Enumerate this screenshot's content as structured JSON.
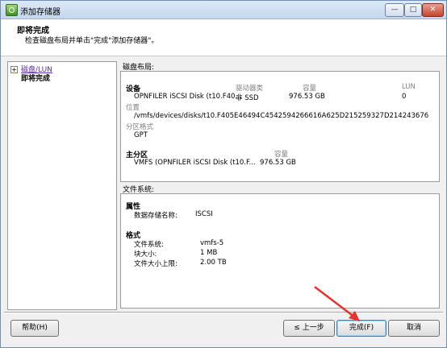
{
  "window": {
    "title": "添加存储器",
    "controls": {
      "minimize": "—",
      "maximize": "□",
      "close": "✕"
    }
  },
  "header": {
    "title": "即将完成",
    "subtitle": "检查磁盘布局并单击\"完成\"添加存储器\"。"
  },
  "nav": {
    "items": [
      {
        "label": "磁盘/LUN",
        "expander": "+"
      },
      {
        "label": "即将完成"
      }
    ]
  },
  "disk_layout": {
    "label": "磁盘布局:",
    "device_header": "设备",
    "col_driver_type": "驱动器类",
    "col_capacity": "容量",
    "col_lun": "LUN",
    "device_name": "OPNFILER iSCSI Disk (t10.F40...",
    "driver_type": "非 SSD",
    "capacity": "976.53 GB",
    "lun": "0",
    "location_label": "位置",
    "location_value": "/vmfs/devices/disks/t10.F405E46494C4542594266616A625D215259327D214243676",
    "partition_format_label": "分区格式",
    "partition_format_value": "GPT",
    "primary_partition_header": "主分区",
    "primary_capacity_header": "容量",
    "primary_partition_name": "VMFS (OPNFILER iSCSI Disk (t10.F...",
    "primary_partition_capacity": "976.53 GB"
  },
  "file_system": {
    "label": "文件系统:",
    "properties_header": "属性",
    "datastore_name_label": "数据存储名称:",
    "datastore_name_value": "ISCSI",
    "format_header": "格式",
    "fs_label": "文件系统:",
    "fs_value": "vmfs-5",
    "block_size_label": "块大小:",
    "block_size_value": "1 MB",
    "max_file_size_label": "文件大小上限:",
    "max_file_size_value": "2.00 TB"
  },
  "footer": {
    "help": "帮助(H)",
    "back": "≤ 上一步",
    "finish": "完成(F)",
    "cancel": "取消"
  },
  "colors": {
    "annotation_arrow": "#e8322a"
  }
}
